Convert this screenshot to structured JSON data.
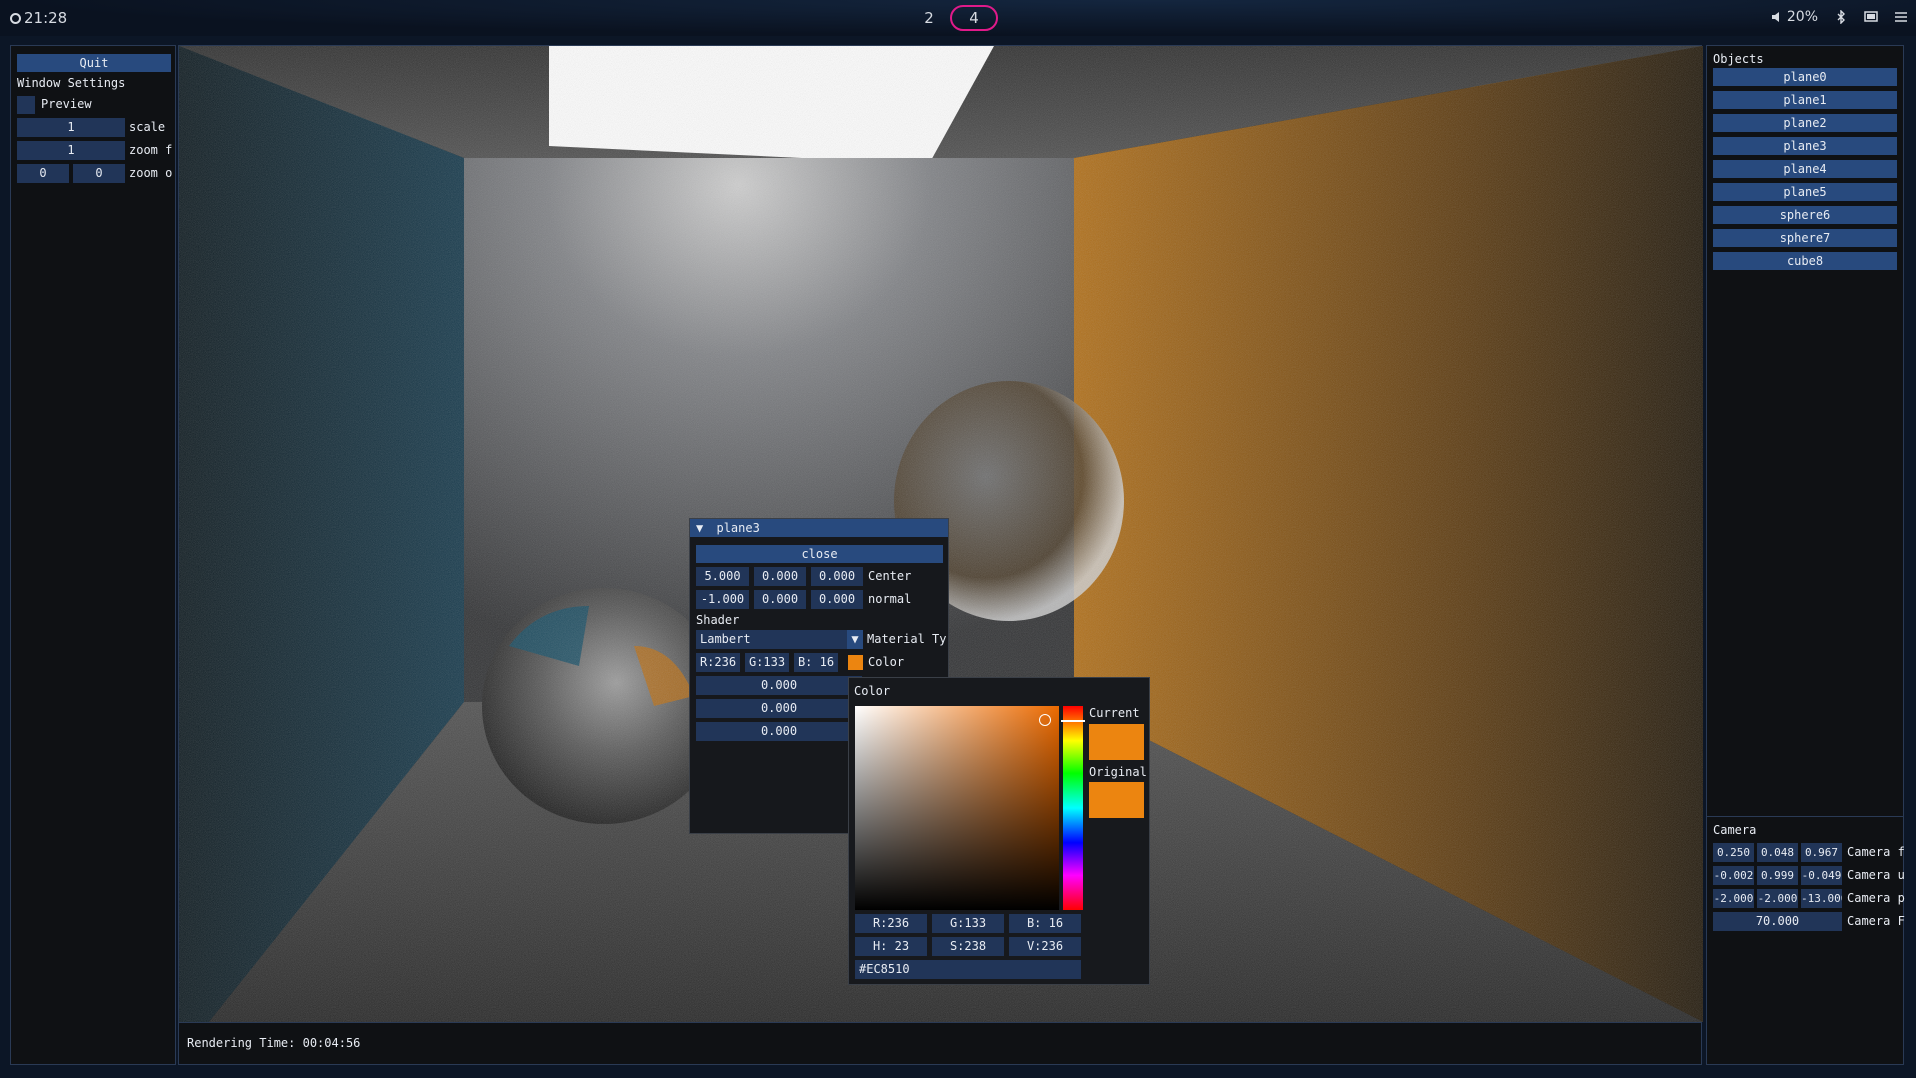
{
  "topbar": {
    "clock": "21:28",
    "workspaces": [
      "2",
      "4"
    ],
    "active_workspace": "4",
    "volume": "20%"
  },
  "left": {
    "quit": "Quit",
    "window_settings": "Window Settings",
    "preview": "Preview",
    "scale_value": "1",
    "scale_label": "scale",
    "zoomf_value": "1",
    "zoomf_label": "zoom f",
    "zoomo_x": "0",
    "zoomo_y": "0",
    "zoomo_label": "zoom o"
  },
  "objects": {
    "title": "Objects",
    "items": [
      "plane0",
      "plane1",
      "plane2",
      "plane3",
      "plane4",
      "plane5",
      "sphere6",
      "sphere7",
      "cube8"
    ]
  },
  "camera": {
    "title": "Camera",
    "rows": [
      {
        "values": [
          "0.250",
          "0.048",
          "0.967"
        ],
        "label": "Camera f"
      },
      {
        "values": [
          "-0.002",
          "0.999",
          "-0.049"
        ],
        "label": "Camera u"
      },
      {
        "values": [
          "-2.000",
          "-2.000",
          "-13.000"
        ],
        "label": "Camera p"
      }
    ],
    "fov_value": "70.000",
    "fov_label": "Camera F"
  },
  "status": {
    "rendering_time": "Rendering Time: 00:04:56"
  },
  "plane_window": {
    "title": "plane3",
    "close": "close",
    "center": [
      "5.000",
      "0.000",
      "0.000"
    ],
    "center_label": "Center",
    "normal": [
      "-1.000",
      "0.000",
      "0.000"
    ],
    "normal_label": "normal",
    "shader_label": "Shader",
    "material_value": "Lambert",
    "material_label": "Material Ty",
    "color_r": "R:236",
    "color_g": "G:133",
    "color_b": "B: 16",
    "color_label": "Color",
    "extra_values": [
      "0.000",
      "0.000",
      "0.000"
    ],
    "swatch": "#EC8510"
  },
  "color_picker": {
    "title": "Color",
    "current_label": "Current",
    "original_label": "Original",
    "r": "R:236",
    "g": "G:133",
    "b": "B: 16",
    "h": "H: 23",
    "s": "S:238",
    "v": "V:236",
    "hex": "#EC8510",
    "current_color": "#EC8510",
    "original_color": "#EC8510"
  }
}
